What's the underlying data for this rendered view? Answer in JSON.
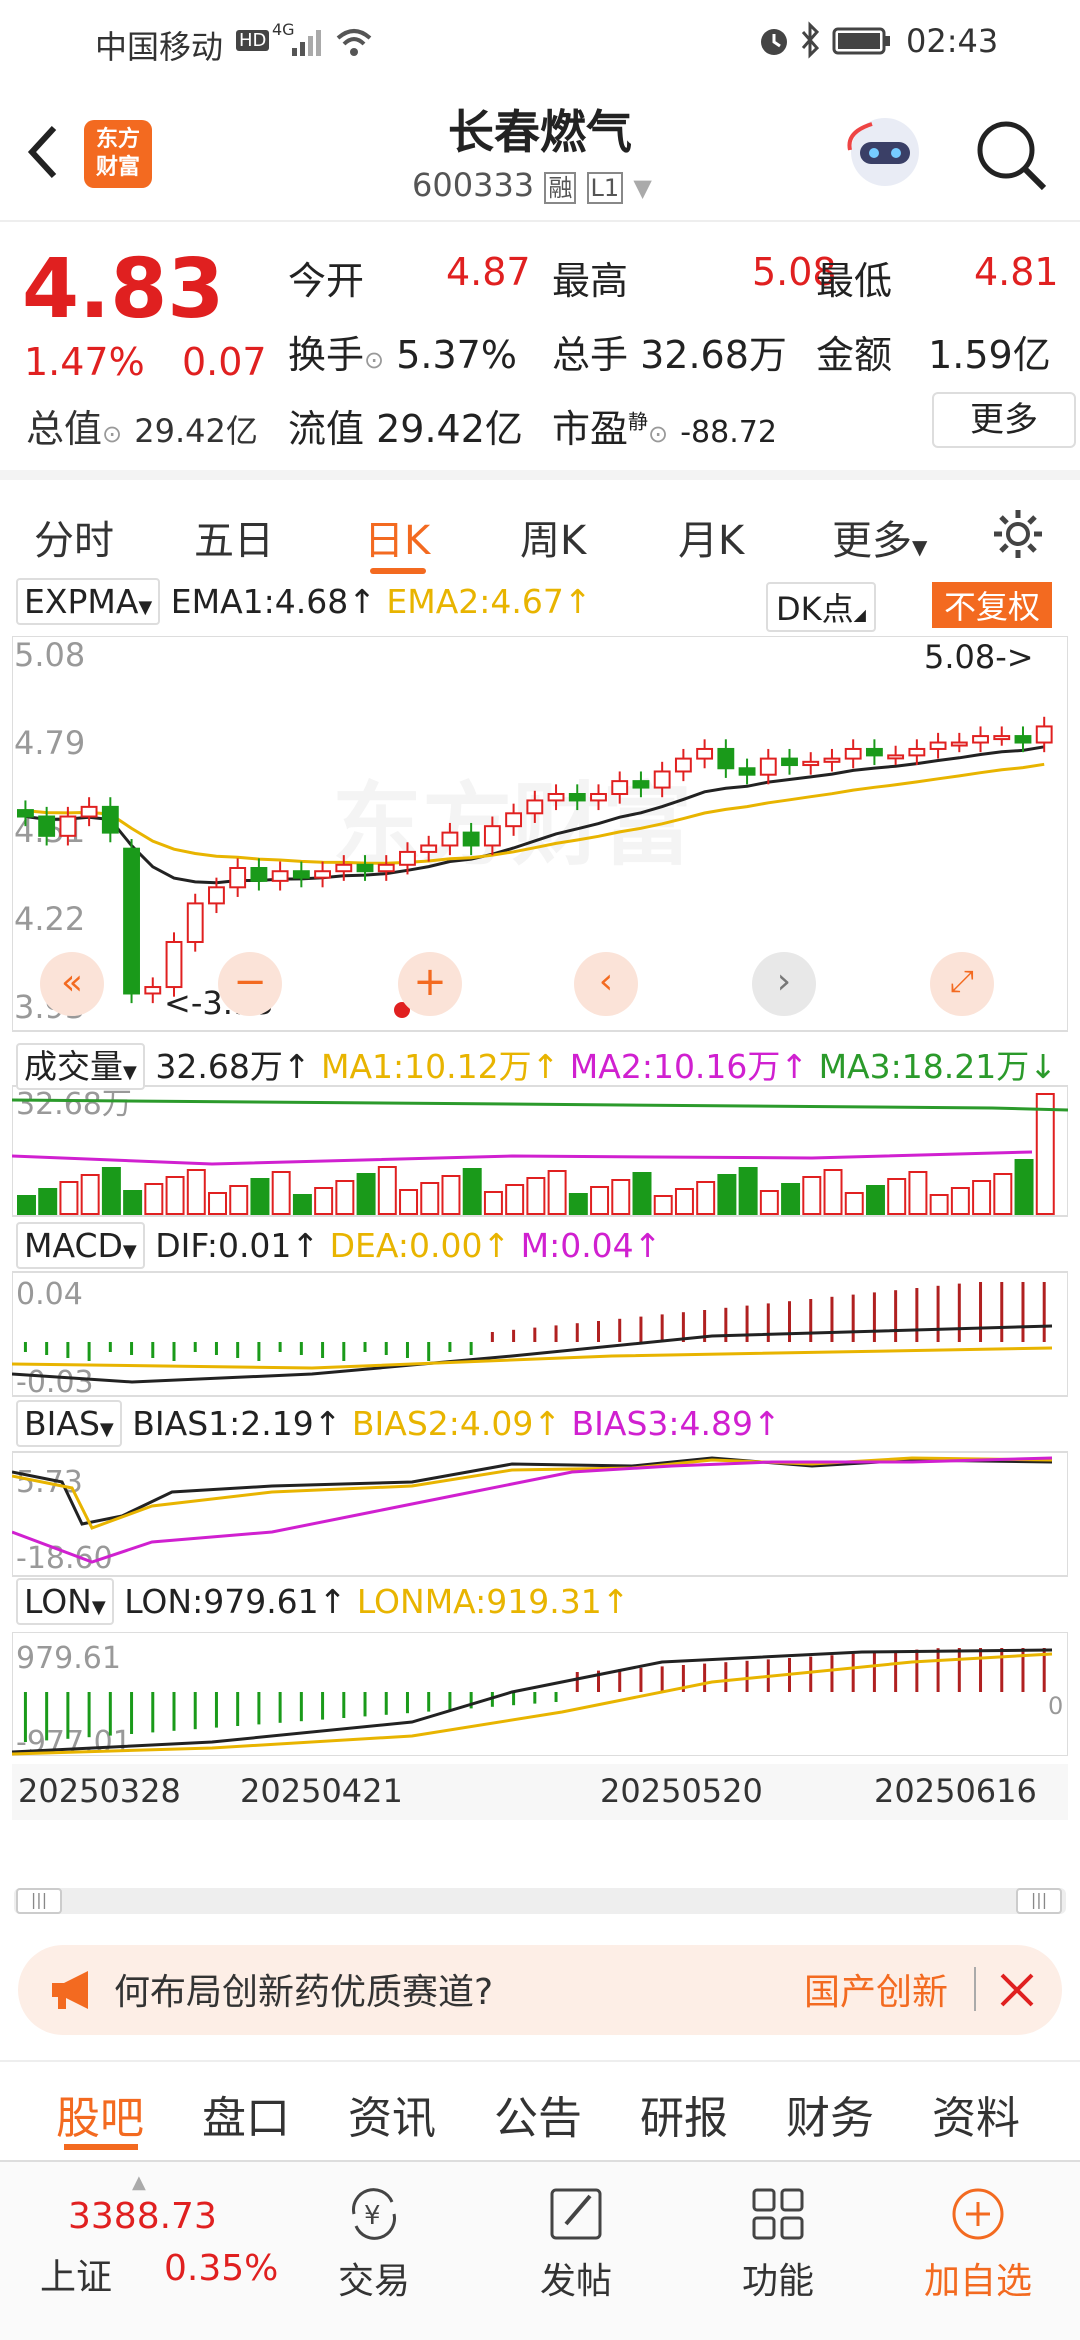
{
  "status": {
    "carrier": "中国移动",
    "hd": "HD",
    "net": "4G",
    "time": "02:43"
  },
  "header": {
    "logo_line1": "东方",
    "logo_line2": "财富",
    "title": "长春燃气",
    "code": "600333",
    "tag_rong": "融",
    "tag_l1": "L1"
  },
  "quote": {
    "price": "4.83",
    "change_pct": "1.47%",
    "change": "0.07",
    "open_label": "今开",
    "open": "4.87",
    "high_label": "最高",
    "high": "5.08",
    "low_label": "最低",
    "low": "4.81",
    "turnover_label": "换手",
    "turnover": "5.37%",
    "volume_label": "总手",
    "volume": "32.68万",
    "amount_label": "金额",
    "amount": "1.59亿",
    "total_mv_label": "总值",
    "total_mv": "29.42亿",
    "float_mv_label": "流值",
    "float_mv": "29.42亿",
    "pe_label": "市盈",
    "pe_sup": "静",
    "pe": "-88.72",
    "more_btn": "更多"
  },
  "period_tabs": [
    "分时",
    "五日",
    "日K",
    "周K",
    "月K",
    "更多"
  ],
  "active_period": "日K",
  "chart": {
    "main_indicator": "EXPMA",
    "ema1": "EMA1:4.68",
    "ema2": "EMA2:4.67",
    "dk_btn": "DK点",
    "fq_btn": "不复权",
    "y_labels": [
      "5.08",
      "4.79",
      "4.51",
      "4.22",
      "3.93"
    ],
    "max_note": "5.08->",
    "min_note": "<-3.93",
    "vol_indicator": "成交量",
    "vol": "32.68万",
    "vol_ma1": "MA1:10.12万",
    "vol_ma2": "MA2:10.16万",
    "vol_ma3": "MA3:18.21万",
    "vol_axis": "32.68万",
    "macd_indicator": "MACD",
    "dif": "DIF:0.01",
    "dea": "DEA:0.00",
    "m": "M:0.04",
    "macd_top": "0.04",
    "macd_bottom": "-0.03",
    "bias_indicator": "BIAS",
    "bias1": "BIAS1:2.19",
    "bias2": "BIAS2:4.09",
    "bias3": "BIAS3:4.89",
    "bias_top": "5.73",
    "bias_bottom": "-18.60",
    "lon_indicator": "LON",
    "lon": "LON:979.61",
    "lonma": "LONMA:919.31",
    "lon_top": "979.61",
    "lon_bottom": "-977.01",
    "lon_right": "0",
    "dates": [
      "20250328",
      "20250421",
      "20250520",
      "20250616"
    ],
    "watermark": "东方财富"
  },
  "chart_data": {
    "type": "candlestick",
    "ylim": [
      3.93,
      5.08
    ],
    "closes": [
      4.55,
      4.49,
      4.55,
      4.58,
      4.5,
      4.0,
      4.02,
      4.16,
      4.28,
      4.33,
      4.39,
      4.35,
      4.38,
      4.36,
      4.38,
      4.4,
      4.38,
      4.4,
      4.44,
      4.46,
      4.5,
      4.46,
      4.52,
      4.56,
      4.6,
      4.62,
      4.6,
      4.62,
      4.66,
      4.64,
      4.69,
      4.73,
      4.76,
      4.7,
      4.68,
      4.73,
      4.71,
      4.72,
      4.73,
      4.76,
      4.74,
      4.74,
      4.76,
      4.78,
      4.78,
      4.8,
      4.8,
      4.78,
      4.83
    ]
  },
  "banner": {
    "text": "何布局创新药优质赛道?",
    "tag": "国产创新"
  },
  "sub_tabs": [
    "股吧",
    "盘口",
    "资讯",
    "公告",
    "研报",
    "财务",
    "资料"
  ],
  "active_sub_tab": "股吧",
  "bottom": {
    "index_value": "3388.73",
    "index_name": "上证",
    "index_pct": "0.35%",
    "trade": "交易",
    "post": "发帖",
    "func": "功能",
    "add": "加自选"
  }
}
